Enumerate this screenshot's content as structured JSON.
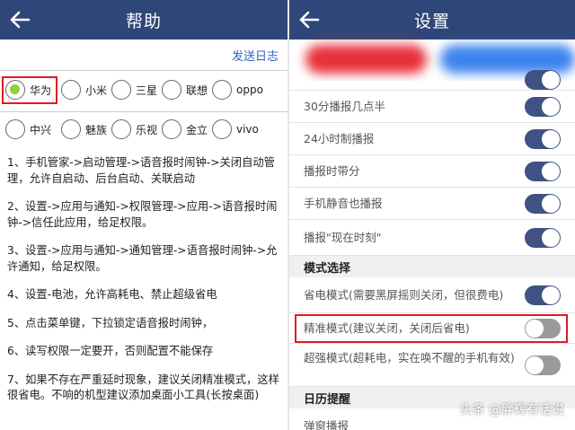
{
  "help": {
    "title": "帮助",
    "send_log": "发送日志",
    "brands": [
      {
        "label": "华为",
        "selected": true
      },
      {
        "label": "小米",
        "selected": false
      },
      {
        "label": "三星",
        "selected": false
      },
      {
        "label": "联想",
        "selected": false
      },
      {
        "label": "oppo",
        "selected": false
      },
      {
        "label": "中兴",
        "selected": false
      },
      {
        "label": "魅族",
        "selected": false
      },
      {
        "label": "乐视",
        "selected": false
      },
      {
        "label": "金立",
        "selected": false
      },
      {
        "label": "vivo",
        "selected": false
      }
    ],
    "instructions": [
      "1、手机管家->启动管理->语音报时闹钟->关闭自动管理，允许自启动、后台启动、关联启动",
      "2、设置->应用与通知->权限管理->应用->语音报时闹钟->信任此应用，给足权限。",
      "3、设置->应用与通知->通知管理->语音报时闹钟->允许通知，给足权限。",
      "4、设置-电池，允许高耗电、禁止超级省电",
      "5、点击菜单键，下拉锁定语音报时闹钟，",
      "6、读写权限一定要开，否则配置不能保存",
      "7、如果不存在严重延时现象，建议关闭精准模式，这样很省电。不响的机型建议添加桌面小工具(长按桌面)"
    ]
  },
  "settings": {
    "title": "设置",
    "rows": [
      {
        "label": "30分播报几点半",
        "on": true
      },
      {
        "label": "24小时制播报",
        "on": true
      },
      {
        "label": "播报时带分",
        "on": true
      },
      {
        "label": "手机静音也播报",
        "on": true
      },
      {
        "label": "播报\"现在时刻\"",
        "on": true
      }
    ],
    "mode_section": "模式选择",
    "mode_rows": [
      {
        "label": "省电模式(需要黑屏摇则关闭，但很费电)",
        "on": true
      },
      {
        "label": "精准模式(建议关闭，关闭后省电)",
        "on": false
      },
      {
        "label": "超强模式(超耗电，实在唤不醒的手机有效)",
        "on": false
      }
    ],
    "calendar_section": "日历提醒",
    "calendar_rows": [
      {
        "label": "弹窗播报"
      }
    ]
  },
  "watermark": "头条 @胖辉有话说",
  "colors": {
    "topbar": "#2f4778",
    "toggle_on": "#3f5283",
    "toggle_off": "#9a9a9a",
    "highlight": "#e01a22",
    "link": "#2d63c8",
    "radio_checked": "#8fd13a"
  },
  "icons": {
    "back": "arrow-left-icon"
  }
}
